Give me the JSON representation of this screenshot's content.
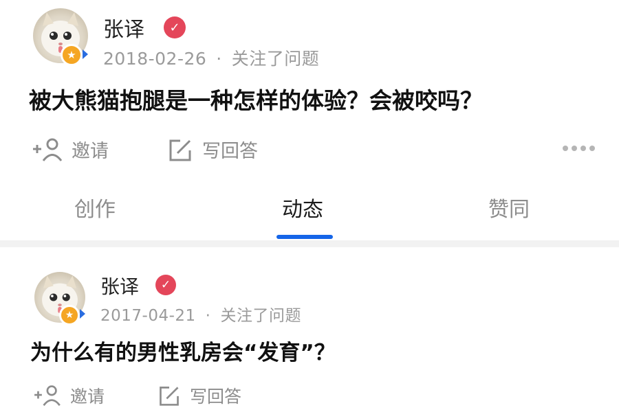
{
  "posts": [
    {
      "author": "张译",
      "date": "2018-02-26",
      "action": "关注了问题",
      "question": "被大熊猫抱腿是一种怎样的体验？会被咬吗？",
      "invite_label": "邀请",
      "answer_label": "写回答"
    },
    {
      "author": "张译",
      "date": "2017-04-21",
      "action": "关注了问题",
      "question": "为什么有的男性乳房会“发育”？",
      "invite_label": "邀请",
      "answer_label": "写回答"
    }
  ],
  "tabs": [
    {
      "label": "创作",
      "active": false
    },
    {
      "label": "动态",
      "active": true
    },
    {
      "label": "赞同",
      "active": false
    }
  ],
  "icons": {
    "avatar": "cat-avatar-icon",
    "badge": "star-badge-icon",
    "verify": "verified-check-icon",
    "invite": "add-person-icon",
    "answer": "edit-pen-icon",
    "more": "more-dots-icon"
  },
  "colors": {
    "accent": "#1565e8",
    "badge": "#f5a623",
    "verify": "#e4465a",
    "muted": "#9a9a9a"
  },
  "separator": "·"
}
